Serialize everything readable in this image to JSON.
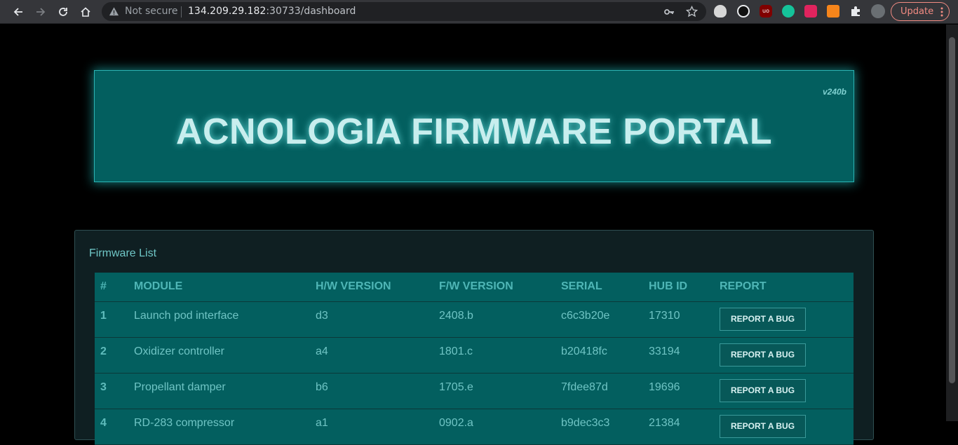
{
  "browser": {
    "not_secure_label": "Not secure",
    "url_host": "134.209.29.182",
    "url_rest": ":30733/dashboard",
    "update_label": "Update",
    "extensions": [
      "shield-extension-icon",
      "ninja-extension-icon",
      "ublock-extension-icon",
      "grammarly-extension-icon",
      "video-extension-icon",
      "metamask-extension-icon",
      "puzzle-extensions-icon",
      "profile-avatar-icon"
    ]
  },
  "banner": {
    "version": "v240b",
    "title": "ACNOLOGIA FIRMWARE PORTAL"
  },
  "panel": {
    "title": "Firmware List"
  },
  "table": {
    "headers": [
      "#",
      "MODULE",
      "H/W VERSION",
      "F/W VERSION",
      "SERIAL",
      "HUB ID",
      "REPORT"
    ],
    "rows": [
      {
        "num": "1",
        "module": "Launch pod interface",
        "hw": "d3",
        "fw": "2408.b",
        "serial": "c6c3b20e",
        "hub": "17310",
        "action": "REPORT A BUG"
      },
      {
        "num": "2",
        "module": "Oxidizer controller",
        "hw": "a4",
        "fw": "1801.c",
        "serial": "b20418fc",
        "hub": "33194",
        "action": "REPORT A BUG"
      },
      {
        "num": "3",
        "module": "Propellant damper",
        "hw": "b6",
        "fw": "1705.e",
        "serial": "7fdee87d",
        "hub": "19696",
        "action": "REPORT A BUG"
      },
      {
        "num": "4",
        "module": "RD-283 compressor",
        "hw": "a1",
        "fw": "0902.a",
        "serial": "b9dec3c3",
        "hub": "21384",
        "action": "REPORT A BUG"
      }
    ]
  },
  "colors": {
    "banner_bg": "#035f5f",
    "accent_text": "#6fc4c4",
    "update_red": "#f28b82"
  }
}
